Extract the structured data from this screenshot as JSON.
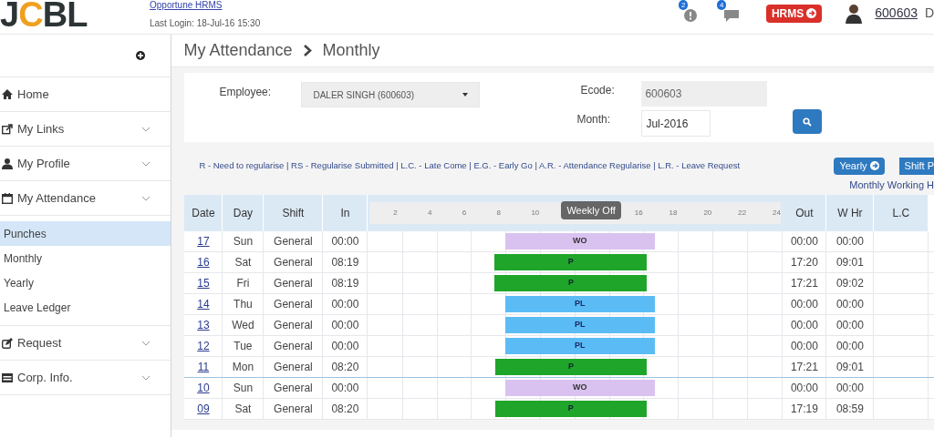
{
  "header": {
    "logo": {
      "first": "J",
      "accent": "C",
      "rest": "BL"
    },
    "app_link": "Opportune HRMS",
    "last_login": "Last Login: 18-Jul-16 15:30",
    "alerts_badge": "2",
    "messages_badge": "4",
    "hrms_button": "HRMS",
    "user_id": "600603",
    "user_name": "D"
  },
  "sidebar": {
    "items": [
      {
        "label": "Home",
        "expandable": false
      },
      {
        "label": "My Links",
        "expandable": true
      },
      {
        "label": "My Profile",
        "expandable": true
      },
      {
        "label": "My Attendance",
        "expandable": true,
        "children": [
          {
            "label": "Punches",
            "selected": true
          },
          {
            "label": "Monthly",
            "selected": false
          },
          {
            "label": "Yearly",
            "selected": false
          },
          {
            "label": "Leave Ledger",
            "selected": false
          }
        ]
      },
      {
        "label": "Request",
        "expandable": true
      },
      {
        "label": "Corp. Info.",
        "expandable": true
      }
    ]
  },
  "breadcrumb": [
    "My Attendance",
    "Monthly"
  ],
  "filters": {
    "employee_label": "Employee:",
    "employee_value": "DALER SINGH (600603)",
    "ecode_label": "Ecode:",
    "ecode_value": "600603",
    "month_label": "Month:",
    "month_value": "Jul-2016"
  },
  "legend": "R - Need to regularise | RS - Regularise Submitted | L.C. - Late Come | E.G. - Early Go | A.R. - Attendance Regularise | L.R. - Leave Request",
  "yearly_button": "Yearly",
  "shift_button": "Shift P",
  "monthly_working": "Monthly Working H",
  "table": {
    "columns": [
      "Date",
      "Day",
      "Shift",
      "In",
      "Out",
      "W Hr",
      "L.C"
    ],
    "ticks": [
      "2",
      "4",
      "6",
      "8",
      "10",
      "16",
      "18",
      "20",
      "22",
      "24"
    ],
    "tooltip": "Weekly Off",
    "rows": [
      {
        "date": "17",
        "day": "Sun",
        "shift": "General",
        "in": "00:00",
        "status": "WO",
        "out": "00:00",
        "whr": "00:00"
      },
      {
        "date": "16",
        "day": "Sat",
        "shift": "General",
        "in": "08:19",
        "status": "P",
        "out": "17:20",
        "whr": "09:01"
      },
      {
        "date": "15",
        "day": "Fri",
        "shift": "General",
        "in": "08:19",
        "status": "P",
        "out": "17:21",
        "whr": "09:02"
      },
      {
        "date": "14",
        "day": "Thu",
        "shift": "General",
        "in": "00:00",
        "status": "PL",
        "out": "00:00",
        "whr": "00:00"
      },
      {
        "date": "13",
        "day": "Wed",
        "shift": "General",
        "in": "00:00",
        "status": "PL",
        "out": "00:00",
        "whr": "00:00"
      },
      {
        "date": "12",
        "day": "Tue",
        "shift": "General",
        "in": "00:00",
        "status": "PL",
        "out": "00:00",
        "whr": "00:00"
      },
      {
        "date": "11",
        "day": "Mon",
        "shift": "General",
        "in": "08:20",
        "status": "P",
        "out": "17:21",
        "whr": "09:01"
      },
      {
        "date": "10",
        "day": "Sun",
        "shift": "General",
        "in": "00:00",
        "status": "WO",
        "out": "00:00",
        "whr": "00:00"
      },
      {
        "date": "09",
        "day": "Sat",
        "shift": "General",
        "in": "08:20",
        "status": "P",
        "out": "17:19",
        "whr": "08:59"
      }
    ]
  }
}
